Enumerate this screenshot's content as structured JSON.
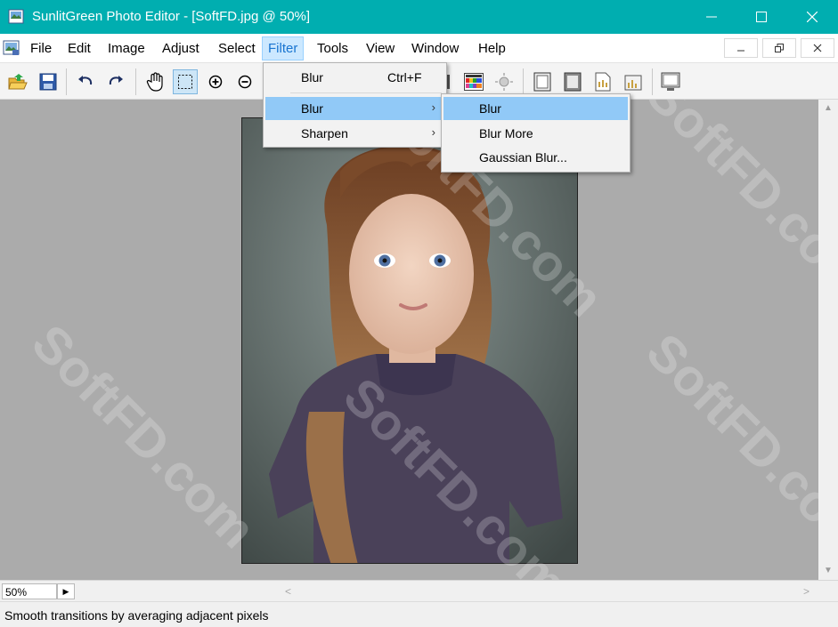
{
  "window": {
    "title": "SunlitGreen Photo Editor - [SoftFD.jpg @ 50%]"
  },
  "menubar": {
    "items": [
      "File",
      "Edit",
      "Image",
      "Adjust",
      "Select",
      "Filter",
      "Tools",
      "View",
      "Window",
      "Help"
    ],
    "active_item": "Filter"
  },
  "toolbar": {
    "buttons": [
      "open-icon",
      "save-icon",
      "undo-icon",
      "redo-icon",
      "hand-icon",
      "marquee-select-icon",
      "zoom-in-icon",
      "zoom-out-icon",
      "grid-icon",
      "color-palette-icon",
      "brightness-icon",
      "frame-icon",
      "border-icon",
      "document-icon",
      "histogram-icon",
      "monitor-icon"
    ],
    "selected": "marquee-select-icon"
  },
  "filter_menu": {
    "items": [
      {
        "label": "Blur",
        "shortcut": "Ctrl+F"
      },
      {
        "label": "Blur",
        "submenu": true
      },
      {
        "label": "Sharpen",
        "submenu": true
      }
    ]
  },
  "blur_submenu": {
    "items": [
      {
        "label": "Blur"
      },
      {
        "label": "Blur More"
      },
      {
        "label": "Gaussian Blur..."
      }
    ]
  },
  "zoom": {
    "value": "50%"
  },
  "status": {
    "text": "Smooth transitions by averaging adjacent pixels"
  },
  "watermark": {
    "text": "SoftFD.com"
  },
  "colors": {
    "titlebar": "#00aeb0",
    "canvas_bg": "#ababab",
    "menu_highlight": "#91c9f7",
    "active_menu_bg": "#cce8ff"
  }
}
